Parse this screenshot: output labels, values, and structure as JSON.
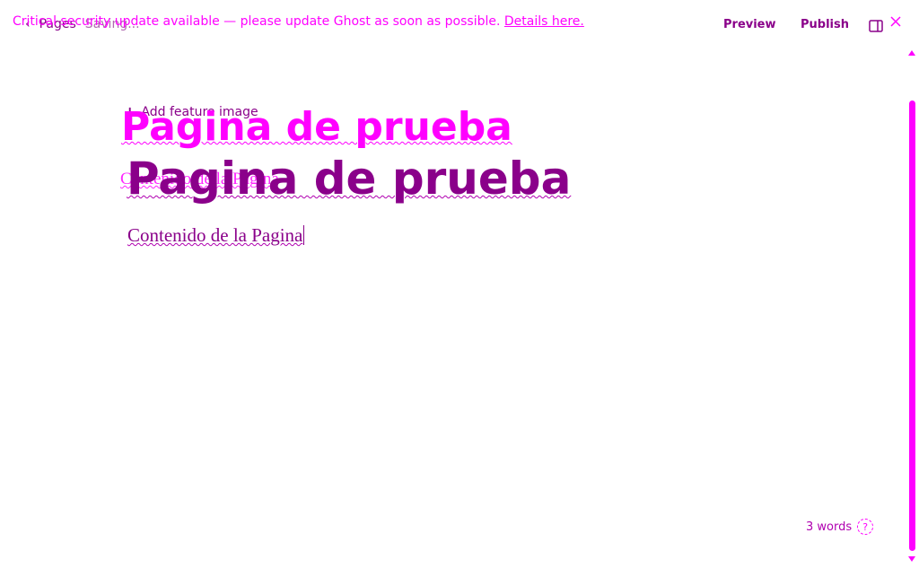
{
  "banner": {
    "text": "Critical security update available — please update Ghost as soon as possible.",
    "link": "Details here."
  },
  "breadcrumb": {
    "back_icon": "chevron-left-icon",
    "section": "Pages",
    "status": "Saving..."
  },
  "toolbar": {
    "preview_label": "Preview",
    "publish_label": "Publish",
    "sidebar_icon": "sidebar-toggle-icon",
    "close_icon": "close-icon"
  },
  "editor": {
    "feature_image_label": "Add feature image",
    "title": "Pagina de prueba",
    "body": "Contenido de la Pagina"
  },
  "footer": {
    "word_count": "3 words",
    "help_icon": "help-icon"
  },
  "colors": {
    "accent": "#ff00ff",
    "primary": "#8a008a"
  }
}
